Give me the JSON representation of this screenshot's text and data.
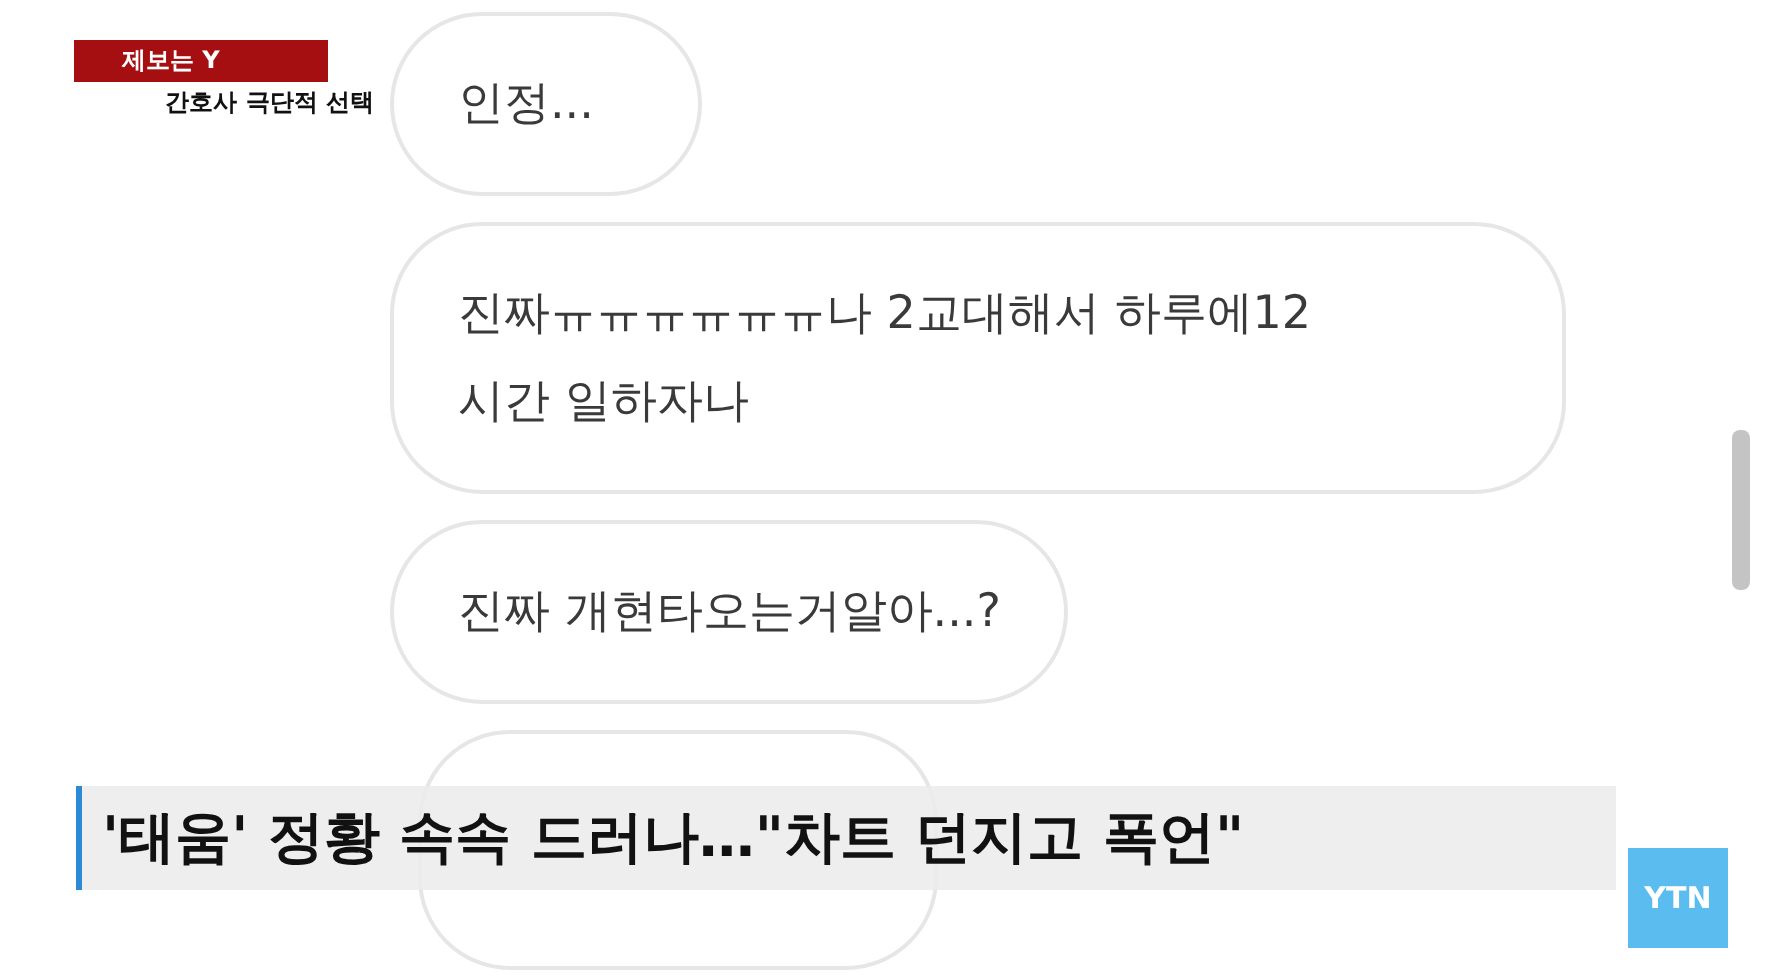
{
  "caption": {
    "tag": "제보는 Y",
    "subtitle": "간호사 극단적 선택"
  },
  "messages": [
    {
      "text": "인정..."
    },
    {
      "text": "진짜ㅠㅠㅠㅠㅠㅠ나 2교대해서 하루에12\n시간 일하자나"
    },
    {
      "text": "진짜 개현타오는거알아...?"
    },
    {
      "kind": "partial"
    }
  ],
  "headline": "'태움' 정황 속속 드러나…\"차트 던지고 폭언\"",
  "logo": "YTN"
}
